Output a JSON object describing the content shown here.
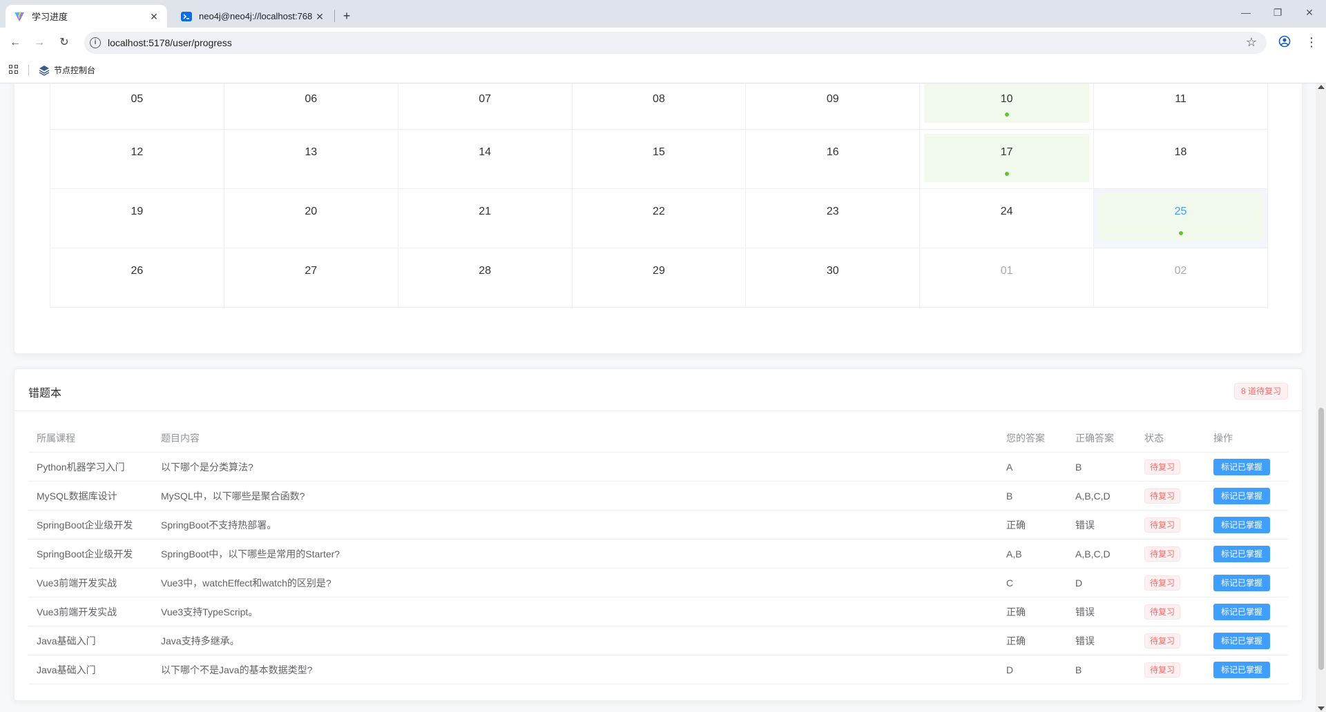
{
  "browser": {
    "tabs": [
      {
        "title": "学习进度",
        "icon": "vite-logo-icon",
        "active": true
      },
      {
        "title": "neo4j@neo4j://localhost:768",
        "icon": "terminal-icon",
        "active": false
      }
    ],
    "url": "localhost:5178/user/progress",
    "bookmarks": [
      {
        "label": "节点控制台",
        "icon": "layers-icon"
      }
    ]
  },
  "calendar": {
    "weeks": [
      [
        {
          "day": "05",
          "state": "normal"
        },
        {
          "day": "06",
          "state": "normal"
        },
        {
          "day": "07",
          "state": "normal"
        },
        {
          "day": "08",
          "state": "normal"
        },
        {
          "day": "09",
          "state": "normal"
        },
        {
          "day": "10",
          "state": "studied"
        },
        {
          "day": "11",
          "state": "normal"
        }
      ],
      [
        {
          "day": "12",
          "state": "normal"
        },
        {
          "day": "13",
          "state": "normal"
        },
        {
          "day": "14",
          "state": "normal"
        },
        {
          "day": "15",
          "state": "normal"
        },
        {
          "day": "16",
          "state": "normal"
        },
        {
          "day": "17",
          "state": "studied"
        },
        {
          "day": "18",
          "state": "normal"
        }
      ],
      [
        {
          "day": "19",
          "state": "normal"
        },
        {
          "day": "20",
          "state": "normal"
        },
        {
          "day": "21",
          "state": "normal"
        },
        {
          "day": "22",
          "state": "normal"
        },
        {
          "day": "23",
          "state": "normal"
        },
        {
          "day": "24",
          "state": "normal"
        },
        {
          "day": "25",
          "state": "today-studied"
        }
      ],
      [
        {
          "day": "26",
          "state": "normal"
        },
        {
          "day": "27",
          "state": "normal"
        },
        {
          "day": "28",
          "state": "normal"
        },
        {
          "day": "29",
          "state": "normal"
        },
        {
          "day": "30",
          "state": "normal"
        },
        {
          "day": "01",
          "state": "other-month"
        },
        {
          "day": "02",
          "state": "other-month"
        }
      ]
    ]
  },
  "wrongbook": {
    "title": "错题本",
    "badge": "8 道待复习",
    "columns": [
      "所属课程",
      "题目内容",
      "您的答案",
      "正确答案",
      "状态",
      "操作"
    ],
    "rows": [
      {
        "course": "Python机器学习入门",
        "question": "以下哪个是分类算法?",
        "your_answer": "A",
        "correct_answer": "B",
        "status": "待复习",
        "action": "标记已掌握"
      },
      {
        "course": "MySQL数据库设计",
        "question": "MySQL中，以下哪些是聚合函数?",
        "your_answer": "B",
        "correct_answer": "A,B,C,D",
        "status": "待复习",
        "action": "标记已掌握"
      },
      {
        "course": "SpringBoot企业级开发",
        "question": "SpringBoot不支持热部署。",
        "your_answer": "正确",
        "correct_answer": "错误",
        "status": "待复习",
        "action": "标记已掌握"
      },
      {
        "course": "SpringBoot企业级开发",
        "question": "SpringBoot中，以下哪些是常用的Starter?",
        "your_answer": "A,B",
        "correct_answer": "A,B,C,D",
        "status": "待复习",
        "action": "标记已掌握"
      },
      {
        "course": "Vue3前端开发实战",
        "question": "Vue3中，watchEffect和watch的区别是?",
        "your_answer": "C",
        "correct_answer": "D",
        "status": "待复习",
        "action": "标记已掌握"
      },
      {
        "course": "Vue3前端开发实战",
        "question": "Vue3支持TypeScript。",
        "your_answer": "正确",
        "correct_answer": "错误",
        "status": "待复习",
        "action": "标记已掌握"
      },
      {
        "course": "Java基础入门",
        "question": "Java支持多继承。",
        "your_answer": "正确",
        "correct_answer": "错误",
        "status": "待复习",
        "action": "标记已掌握"
      },
      {
        "course": "Java基础入门",
        "question": "以下哪个不是Java的基本数据类型?",
        "your_answer": "D",
        "correct_answer": "B",
        "status": "待复习",
        "action": "标记已掌握"
      }
    ]
  },
  "colors": {
    "primary": "#409eff",
    "danger": "#f56c6c",
    "success": "#67c23a",
    "studied_bg": "#f0f9eb"
  }
}
